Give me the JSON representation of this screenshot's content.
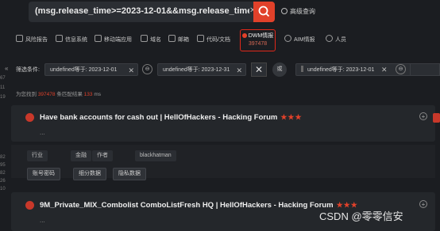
{
  "search": {
    "query": "(msg.release_time>=2023-12-01&&msg.release_time<=",
    "advanced_label": "高级查询"
  },
  "nav": {
    "items": [
      {
        "label": "风险报告"
      },
      {
        "label": "信息系统"
      },
      {
        "label": "移动端应用"
      },
      {
        "label": "域名"
      },
      {
        "label": "邮箱"
      },
      {
        "label": "代码/文档"
      },
      {
        "label": "DWM情报",
        "count": "397478",
        "active": true
      },
      {
        "label": "AIM情报"
      },
      {
        "label": "人员"
      }
    ]
  },
  "ruler": [
    "67",
    "11",
    "19",
    "82",
    "95",
    "82",
    "26",
    "10"
  ],
  "filter": {
    "label": "筛选条件:",
    "chips": [
      "undefined等于: 2023-12-01",
      "undefined等于: 2023-12-31",
      "undefined等于: 2023-12-01"
    ],
    "and_label": "⊖",
    "or_label": "或"
  },
  "summary": {
    "prefix": "为您找到",
    "count": "397478",
    "middle": "条匹配结果",
    "time": "133",
    "suffix": "ms"
  },
  "results": [
    {
      "title": "Have bank accounts for cash out | HellOfHackers - Hacking Forum",
      "stars": "★★★",
      "snippet": "...",
      "tags": [
        "行业",
        "金融",
        "作者",
        "blackhatman"
      ],
      "buttons": [
        "账号密码",
        "细分数据",
        "隐私数据"
      ]
    },
    {
      "title": "9M_Private_MIX_Combolist ComboListFresh HQ | HellOfHackers - Hacking Forum",
      "stars": "★★★",
      "snippet": "..."
    }
  ],
  "watermark": "CSDN @零零信安",
  "colors": {
    "accent": "#e1412a",
    "background": "#1b1d21",
    "card": "#24272b"
  }
}
